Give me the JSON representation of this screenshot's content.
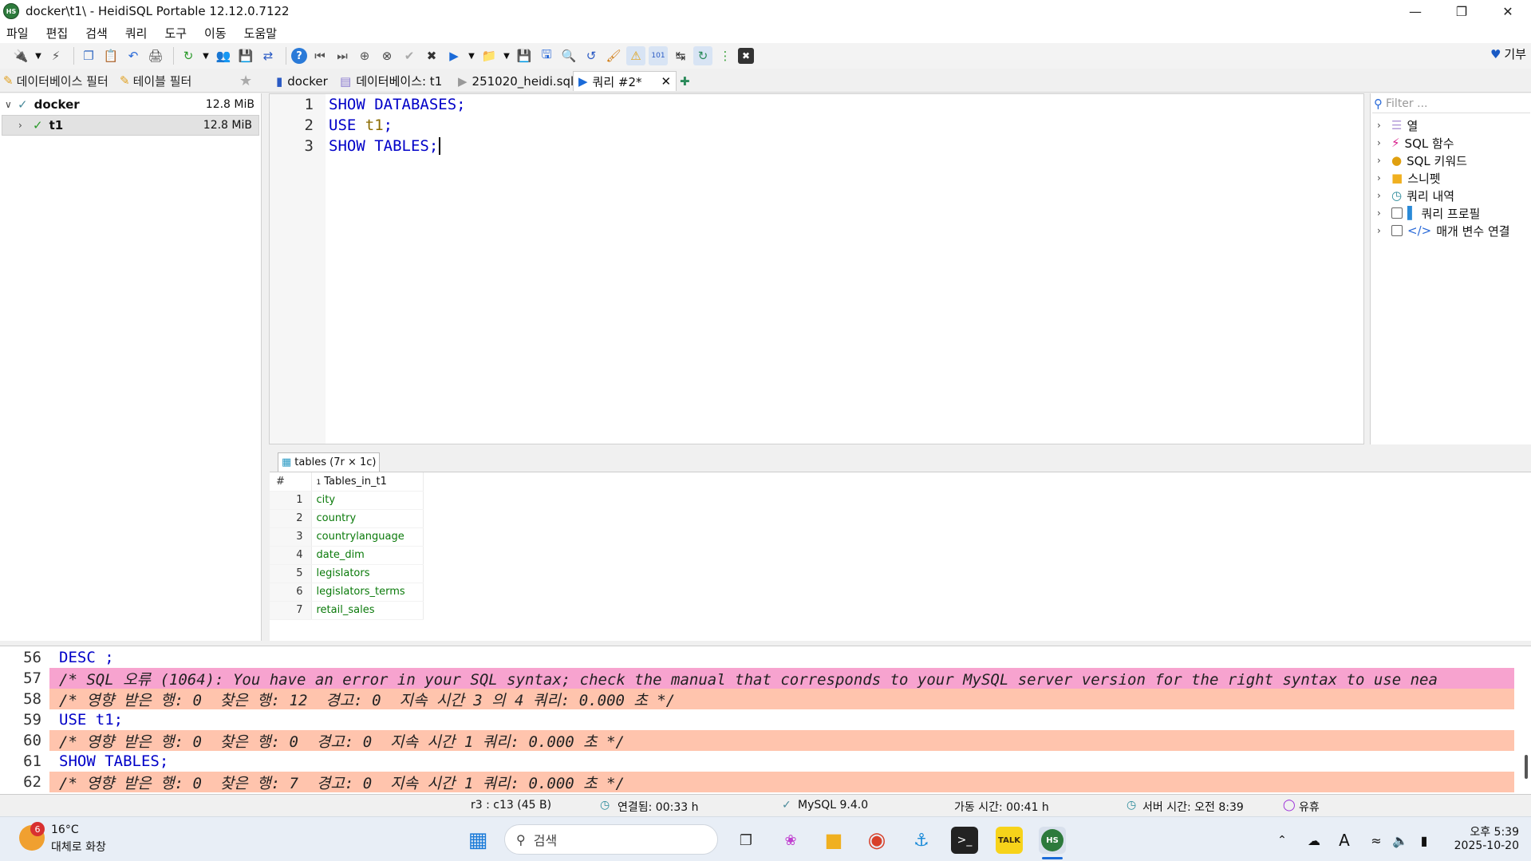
{
  "window": {
    "title": "docker\\t1\\ - HeidiSQL Portable 12.12.0.7122",
    "app_icon": "HS"
  },
  "menu": [
    "파일",
    "편집",
    "검색",
    "쿼리",
    "도구",
    "이동",
    "도움말"
  ],
  "donate_label": "기부",
  "tabs": {
    "db_filter": "데이터베이스 필터",
    "table_filter": "테이블 필터",
    "host": "docker",
    "database": "데이터베이스: t1",
    "file": "251020_heidi.sql",
    "query": "쿼리 #2*"
  },
  "tree": [
    {
      "label": "docker",
      "size": "12.8 MiB"
    },
    {
      "label": "t1",
      "size": "12.8 MiB"
    }
  ],
  "editor": {
    "lines": [
      {
        "num": "1",
        "kw1": "SHOW DATABASES;",
        "ident": ""
      },
      {
        "num": "2",
        "kw1": "USE ",
        "ident": "t1",
        "tail": ";"
      },
      {
        "num": "3",
        "kw1": "SHOW TABLES;",
        "ident": ""
      }
    ]
  },
  "helpers": {
    "filter_placeholder": "Filter ...",
    "items": [
      "열",
      "SQL 함수",
      "SQL 키워드",
      "스니펫",
      "쿼리 내역",
      "쿼리 프로필",
      "매개 변수 연결"
    ]
  },
  "results": {
    "tab_label": "tables (7r × 1c)",
    "hash": "#",
    "column_index": "1",
    "column": "Tables_in_t1",
    "rows": [
      {
        "n": "1",
        "v": "city"
      },
      {
        "n": "2",
        "v": "country"
      },
      {
        "n": "3",
        "v": "countrylanguage"
      },
      {
        "n": "4",
        "v": "date_dim"
      },
      {
        "n": "5",
        "v": "legislators"
      },
      {
        "n": "6",
        "v": "legislators_terms"
      },
      {
        "n": "7",
        "v": "retail_sales"
      }
    ]
  },
  "log": [
    {
      "num": "56",
      "text": "DESC ;",
      "kind": "sql"
    },
    {
      "num": "57",
      "text": "/* SQL 오류 (1064): You have an error in your SQL syntax; check the manual that corresponds to your MySQL server version for the right syntax to use nea",
      "kind": "err"
    },
    {
      "num": "58",
      "text": "/* 영향 받은 행: 0  찾은 행: 12  경고: 0  지속 시간 3 의 4 쿼리: 0.000 초 */",
      "kind": "info"
    },
    {
      "num": "59",
      "text": "USE t1;",
      "kind": "sql"
    },
    {
      "num": "60",
      "text": "/* 영향 받은 행: 0  찾은 행: 0  경고: 0  지속 시간 1 쿼리: 0.000 초 */",
      "kind": "info"
    },
    {
      "num": "61",
      "text": "SHOW TABLES;",
      "kind": "sql"
    },
    {
      "num": "62",
      "text": "/* 영향 받은 행: 0  찾은 행: 7  경고: 0  지속 시간 1 쿼리: 0.000 초 */",
      "kind": "info"
    }
  ],
  "status": {
    "cursor": "r3 : c13 (45 B)",
    "connected": "연결됨: 00:33 h",
    "server": "MySQL 9.4.0",
    "uptime": "가동 시간: 00:41 h",
    "server_time": "서버 시간: 오전 8:39",
    "idle": "유휴"
  },
  "taskbar": {
    "weather_badge": "6",
    "temperature": "16°C",
    "weather_desc": "대체로 화창",
    "search_placeholder": "검색",
    "time": "오후 5:39",
    "date": "2025-10-20"
  },
  "colors": {
    "keyword": "#0000c8",
    "error_bg": "#f7a3cf",
    "info_bg": "#ffc4ad",
    "cell_text": "#0a7a0a"
  }
}
